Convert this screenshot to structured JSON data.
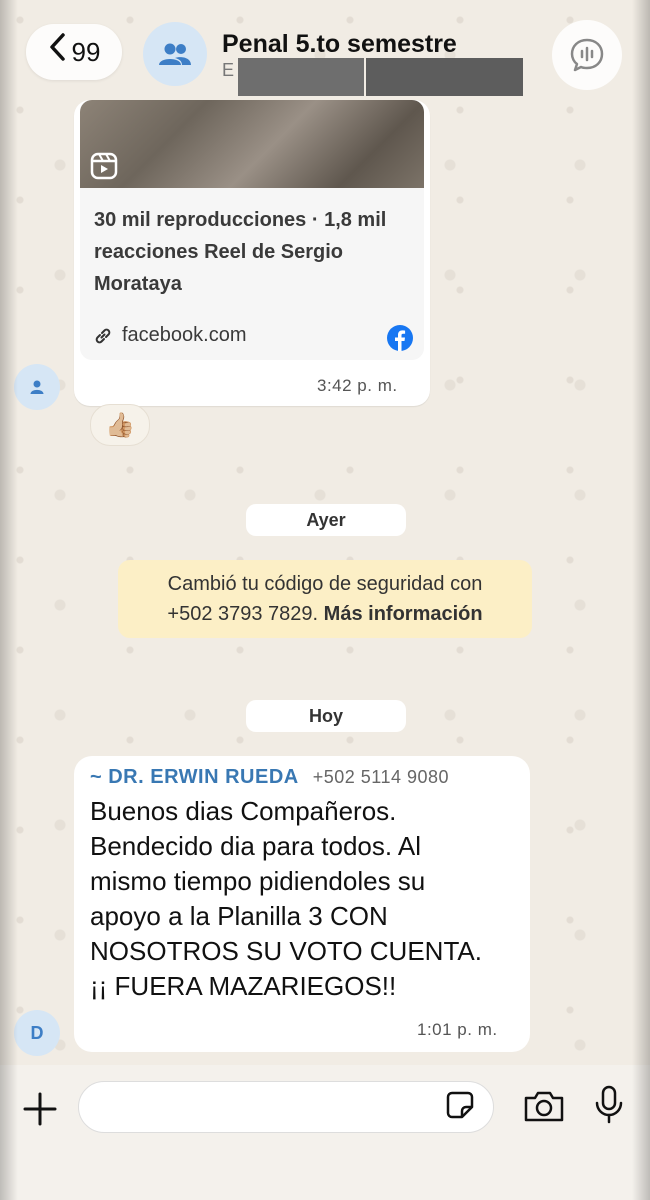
{
  "header": {
    "back_count": "99",
    "back_chevron": "<",
    "title": "Penal 5.to semestre",
    "subtitle": "E",
    "avatar_icon": "group-icon",
    "call_icon": "audio-call-icon"
  },
  "link_message": {
    "preview_title": "30 mil reproducciones · 1,8 mil reacciones Reel de Sergio Morataya",
    "domain": "facebook.com",
    "time": "3:42 p. m.",
    "reaction": "👍🏼"
  },
  "date_chips": {
    "yesterday": "Ayer",
    "today": "Hoy"
  },
  "security_notice": {
    "line1": "Cambió tu código de seguridad con",
    "line2_number": "+502 3793 7829.",
    "line2_link": "Más información"
  },
  "message": {
    "sender_name": "~ DR. ERWIN RUEDA",
    "sender_phone": "+502 5114 9080",
    "avatar_letter": "D",
    "lines": [
      "Buenos dias Compañeros.",
      "Bendecido dia para todos. Al",
      "mismo tiempo pidiendoles su",
      "apoyo a la Planilla 3 CON",
      "NOSOTROS SU VOTO CUENTA.",
      "¡¡ FUERA MAZARIEGOS!!"
    ],
    "time": "1:01 p. m."
  },
  "input_bar": {
    "placeholder": "",
    "icons": [
      "plus-icon",
      "sticker-icon",
      "camera-icon",
      "microphone-icon"
    ]
  },
  "colors": {
    "sender_name": "#3978b3",
    "notice_bg": "#fcefc6",
    "facebook": "#1877f2",
    "avatar_bg": "#d6e6f5"
  }
}
